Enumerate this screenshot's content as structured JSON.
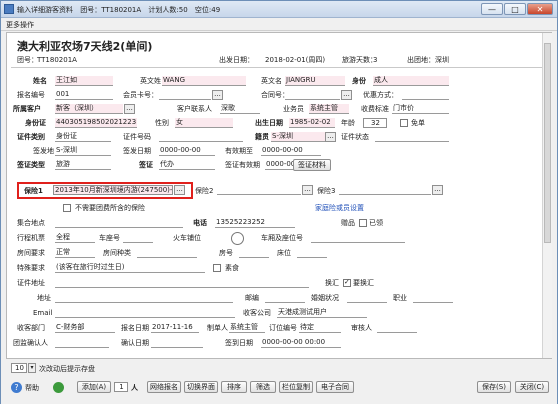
{
  "window": {
    "title": "输入详细游客资料",
    "group_label": "团号：",
    "group_no": "TT180201A",
    "plan_label": "计划人数:50",
    "occupied_label": "空位:49",
    "min": "—",
    "max": "□",
    "close": "✕"
  },
  "menu": {
    "more_ops": "更多操作"
  },
  "header": {
    "tour_name": "澳大利亚农场7天线2(单间)",
    "group_label": "团号：",
    "group_no": "TT180201A",
    "depart_label": "出发日期：",
    "depart_date": "2018-02-01(周四)",
    "days_label": "旅游天数：",
    "days": "3",
    "place_label": "出团地：",
    "place": "深圳"
  },
  "form": {
    "name_label": "姓名",
    "name": "王江如",
    "en_surname_label": "英文姓",
    "en_surname": "WANG",
    "en_name_label": "英文名",
    "en_name": "JIANGRU",
    "identity_label": "身份",
    "identity": "成人",
    "signup_no_label": "报名编号",
    "signup_no": "001",
    "member_card_label": "会员卡号：",
    "contract_label": "合同号：",
    "discount_label": "优惠方式：",
    "customer_label": "所属客户",
    "customer": "新客（深圳）",
    "cust_contact_label": "客户联系人",
    "cust_contact": "深歌",
    "agent_label": "业务员",
    "agent": "系统主管",
    "receipt_label": "收费标准",
    "receipt": "门市价",
    "id_card_label": "身份证",
    "id_card": "440305198502021223",
    "gender_label": "性别",
    "gender": "女",
    "birth_label": "出生日期",
    "birth": "1985-02-02",
    "age_label": "年龄",
    "age": "32",
    "exempt_label": "免单",
    "doc_type_label": "证件类别",
    "doc_type": "身份证",
    "doc_no_label": "证件号码",
    "nationality_label": "籍贯",
    "nationality": "S-深圳",
    "doc_status_label": "证件状态",
    "issue_place_label": "签发地",
    "issue_place": "S-深圳",
    "issue_date_label": "签发日期",
    "issue_date": "0000-00-00",
    "valid_label": "有效期至",
    "valid_date": "0000-00-00",
    "visa_type_label": "签证类型",
    "visa_type": "旅游",
    "visa_label": "签证",
    "visa": "代办",
    "visa_valid_label": "签证有效期",
    "visa_valid": "0000-00-00",
    "visa_material_btn": "签证材料",
    "insurance1_label": "保险1",
    "insurance1": "2013年10月新深圳境内游(247500)-$",
    "insurance2_label": "保险2",
    "insurance3_label": "保险3",
    "group_insurance_link": "家庭险或员设置",
    "no_group_ins_label": "不需要团费所含的保险",
    "gather_label": "集合地点",
    "phone_label": "电话",
    "phone": "13525223252",
    "gift_label": "赠品",
    "gift_btn": "已领",
    "ticket_label": "行程机票",
    "ticket": "全程",
    "car_no_label": "车座号",
    "train_label": "火车铺位",
    "car_seat_label": "车厢及座位号",
    "room_req_label": "房间要求",
    "room_req": "正常",
    "room_type_label": "房间种类",
    "room_no_label": "房号",
    "bed_label": "床位",
    "special_label": "特殊要求",
    "special": "(该客在旅行时过生日)",
    "vegetarian_label": "素食",
    "doc_addr_label": "证件地址",
    "transfer_label": "换汇",
    "need_transfer_label": "要换汇",
    "address_label": "地址",
    "postcode_label": "邮编",
    "marital_label": "婚姻状况",
    "job_label": "职业",
    "email_label": "Email",
    "receive_company_label": "收客公司",
    "receive_company": "天港成测试用户",
    "receive_dept_label": "收客部门",
    "receive_dept": "C-财务部",
    "signup_date_label": "报名日期",
    "signup_date": "2017-11-16",
    "maker_label": "制单人",
    "maker": "系统主管",
    "order_label": "订位编号",
    "order": "待定",
    "auditor_label": "审核人",
    "confirm_label": "团监确认人",
    "confirm_date_label": "确认日期",
    "signin_time_label": "签到日期",
    "signin_time": "0000-00-00 00:00"
  },
  "footer": {
    "remind_count": "10",
    "remind_label": "次改动后提示存盘",
    "help_label": "帮助",
    "add_btn": "添加(A)",
    "count": "1",
    "person": "人",
    "net_signup": "网络报名",
    "switch_view": "切换界面",
    "sort": "排序",
    "filter": "筛选",
    "copy_col": "栏位复制",
    "e_contract": "电子合同",
    "save_btn": "保存(S)",
    "close_btn": "关闭(C)"
  }
}
